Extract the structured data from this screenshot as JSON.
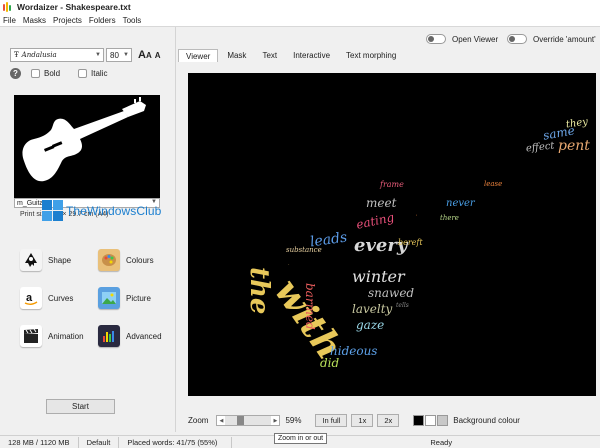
{
  "window": {
    "title": "Wordaizer - Shakespeare.txt"
  },
  "menu": [
    "File",
    "Masks",
    "Projects",
    "Folders",
    "Tools"
  ],
  "font_panel": {
    "font_name": "Andalusia",
    "font_size": "80",
    "bold_label": "Bold",
    "italic_label": "Italic"
  },
  "shape_panel": {
    "mask_name": "m_Guitar",
    "print_size": "Print size: 21 × 29.7 cm (A4)"
  },
  "watermark": {
    "text": "TheWindowsClub"
  },
  "tools": [
    {
      "label": "Shape",
      "icon": "inkscape-shape-icon"
    },
    {
      "label": "Colours",
      "icon": "palette-icon"
    },
    {
      "label": "Curves",
      "icon": "amazon-curves-icon"
    },
    {
      "label": "Picture",
      "icon": "picture-icon"
    },
    {
      "label": "Animation",
      "icon": "clapperboard-icon"
    },
    {
      "label": "Advanced",
      "icon": "equalizer-icon"
    }
  ],
  "start_label": "Start",
  "options": {
    "open_viewer": "Open Viewer",
    "override_amount": "Override 'amount'"
  },
  "tabs": [
    "Viewer",
    "Mask",
    "Text",
    "Interactive",
    "Text morphing"
  ],
  "active_tab": "Viewer",
  "zoom": {
    "label": "Zoom",
    "value": "59%",
    "in_full": "In full",
    "x1": "1x",
    "x2": "2x",
    "bg_label": "Background colour",
    "tooltip": "Zoom in or out"
  },
  "status": {
    "memory": "128 MB / 1120 MB",
    "mode": "Default",
    "placed": "Placed words: 41/75 (55%)",
    "state": "Ready"
  },
  "colors": {
    "canvas_bg": "#000000",
    "accent": "#1c7fcf"
  },
  "word_cloud": [
    {
      "text": "they",
      "color": "#e8e8a0"
    },
    {
      "text": "same",
      "color": "#6ca6e8"
    },
    {
      "text": "pent",
      "color": "#e8a870"
    },
    {
      "text": "effect",
      "color": "#bfbfbf"
    },
    {
      "text": "frame",
      "color": "#e85c7a"
    },
    {
      "text": "lease",
      "color": "#e8803c"
    },
    {
      "text": "meet",
      "color": "#c0c0c0"
    },
    {
      "text": "never",
      "color": "#4aa0e8"
    },
    {
      "text": "eating",
      "color": "#e8507a"
    },
    {
      "text": "there",
      "color": "#b8d88a"
    },
    {
      "text": "leads",
      "color": "#5c9ce8"
    },
    {
      "text": "every",
      "color": "#d8d8d8"
    },
    {
      "text": "winter",
      "color": "#e0e0e0"
    },
    {
      "text": "with",
      "color": "#e8c85a"
    },
    {
      "text": "the",
      "color": "#e8c85a"
    },
    {
      "text": "snawed",
      "color": "#bfbfbf"
    },
    {
      "text": "lavelty",
      "color": "#c8c8a0"
    },
    {
      "text": "gaze",
      "color": "#9ad8e8"
    },
    {
      "text": "hideous",
      "color": "#5ca0e8"
    },
    {
      "text": "did",
      "color": "#b8e05a"
    },
    {
      "text": "barmed",
      "color": "#e85c5c"
    },
    {
      "text": "substance",
      "color": "#e8d0a0"
    },
    {
      "text": "bereft",
      "color": "#e8c85a"
    },
    {
      "text": "tells",
      "color": "#8a8a8a"
    }
  ]
}
